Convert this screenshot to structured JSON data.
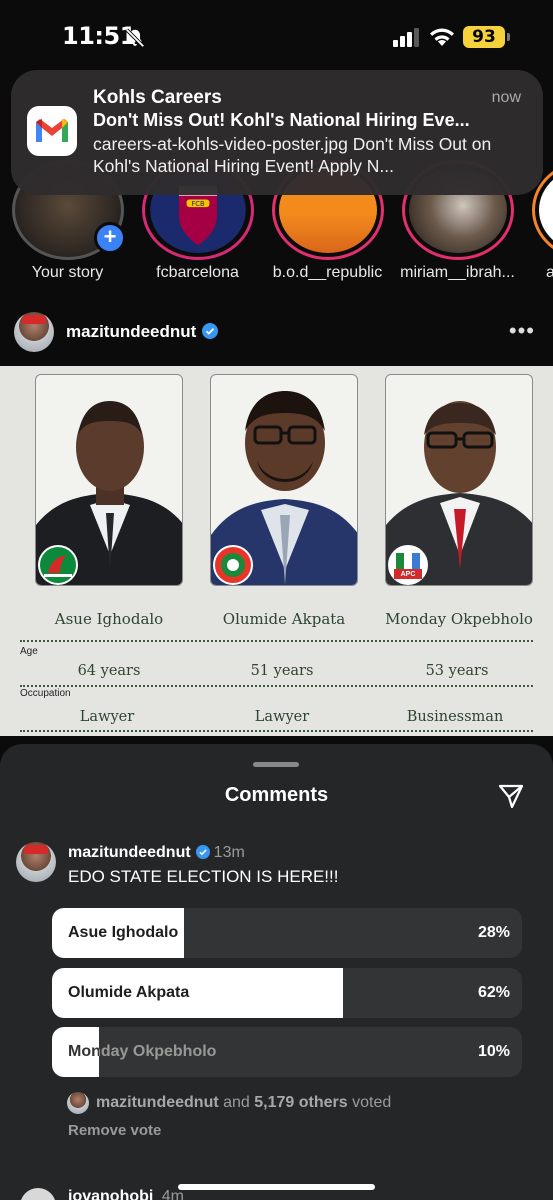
{
  "status_bar": {
    "time": "11:51",
    "battery": "93",
    "battery_color": "#f5d13b"
  },
  "notification": {
    "app": "Kohls Careers",
    "time": "now",
    "title": "Don't Miss Out! Kohl's National Hiring Eve...",
    "body": "careers-at-kohls-video-poster.jpg Don't Miss Out on Kohl's National Hiring Event! Apply N...",
    "icon": "gmail-icon"
  },
  "stories": [
    {
      "label": "Your story"
    },
    {
      "label": "fcbarcelona"
    },
    {
      "label": "b.o.d__republic"
    },
    {
      "label": "miriam__ibrah..."
    },
    {
      "label": "a"
    }
  ],
  "post": {
    "username": "mazitundeednut",
    "more": "•••",
    "infographic": {
      "candidates": [
        {
          "name": "Asue Ighodalo",
          "age": "64 years",
          "occupation": "Lawyer"
        },
        {
          "name": "Olumide Akpata",
          "age": "51 years",
          "occupation": "Lawyer"
        },
        {
          "name": "Monday Okpebholo",
          "age": "53 years",
          "occupation": "Businessman"
        }
      ],
      "age_label": "Age",
      "occupation_label": "Occupation",
      "logo_text_apc": "APC"
    }
  },
  "comments_sheet": {
    "title": "Comments",
    "comment": {
      "username": "mazitundeednut",
      "time": "13m",
      "text": "EDO STATE ELECTION IS HERE!!!"
    },
    "poll": [
      {
        "label": "Asue Ighodalo",
        "percent": "28%",
        "fraction": 0.28
      },
      {
        "label": "Olumide Akpata",
        "percent": "62%",
        "fraction": 0.62
      },
      {
        "label": "Monday Okpebholo",
        "percent": "10%",
        "fraction": 0.1
      }
    ],
    "votes": {
      "user": "mazitundeednut",
      "and": "and",
      "others": "5,179 others",
      "suffix": "voted"
    },
    "remove_vote": "Remove vote",
    "next_comment_user": "jovanohobi",
    "next_comment_time": "4m"
  }
}
